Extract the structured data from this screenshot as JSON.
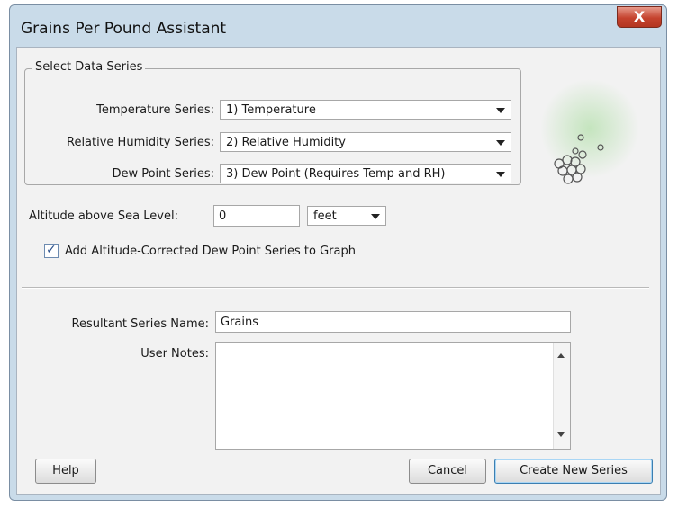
{
  "window": {
    "title": "Grains Per Pound Assistant",
    "close_glyph": "X"
  },
  "data_series": {
    "legend": "Select Data Series",
    "temperature": {
      "label": "Temperature Series:",
      "value": "1) Temperature"
    },
    "humidity": {
      "label": "Relative Humidity Series:",
      "value": "2) Relative Humidity"
    },
    "dew_point": {
      "label": "Dew Point Series:",
      "value": "3) Dew Point (Requires Temp and RH)"
    }
  },
  "altitude": {
    "label": "Altitude above Sea Level:",
    "value": "0",
    "unit": "feet"
  },
  "altitude_corrected": {
    "label": "Add Altitude-Corrected Dew Point Series to Graph",
    "checked": true
  },
  "result": {
    "name_label": "Resultant Series Name:",
    "name_value": "Grains",
    "notes_label": "User Notes:",
    "notes_value": ""
  },
  "buttons": {
    "help": "Help",
    "cancel": "Cancel",
    "create": "Create New Series"
  },
  "icons": {
    "decoration": "bubbles-icon",
    "close": "close-icon",
    "check": "check-icon"
  },
  "colors": {
    "title_bar": "#c9dbe9",
    "close_button": "#c5432e",
    "default_button_border": "#3c7fb1"
  }
}
